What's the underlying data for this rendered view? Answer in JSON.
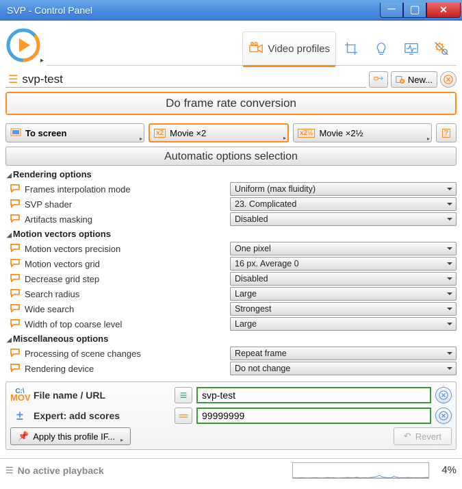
{
  "window": {
    "title": "SVP - Control Panel"
  },
  "tabs": {
    "video_profiles": "Video profiles"
  },
  "profile": {
    "name": "svp-test",
    "new_btn": "New..."
  },
  "panel": {
    "header": "Do frame rate conversion"
  },
  "modes": {
    "screen": "To screen",
    "x2": "Movie ×2",
    "x25": "Movie ×2½"
  },
  "auto_header": "Automatic options selection",
  "sections": {
    "rendering": "Rendering options",
    "motion": "Motion vectors options",
    "misc": "Miscellaneous options"
  },
  "options": {
    "frames_interp": {
      "label": "Frames interpolation mode",
      "value": "Uniform (max fluidity)"
    },
    "svp_shader": {
      "label": "SVP shader",
      "value": "23. Complicated"
    },
    "artifacts": {
      "label": "Artifacts masking",
      "value": "Disabled"
    },
    "mv_precision": {
      "label": "Motion vectors precision",
      "value": "One pixel"
    },
    "mv_grid": {
      "label": "Motion vectors grid",
      "value": "16 px. Average 0"
    },
    "decrease_grid": {
      "label": "Decrease grid step",
      "value": "Disabled"
    },
    "search_radius": {
      "label": "Search radius",
      "value": "Large"
    },
    "wide_search": {
      "label": "Wide search",
      "value": "Strongest"
    },
    "width_coarse": {
      "label": "Width of top coarse level",
      "value": "Large"
    },
    "scene_changes": {
      "label": "Processing of scene changes",
      "value": "Repeat frame"
    },
    "render_device": {
      "label": "Rendering device",
      "value": "Do not change"
    }
  },
  "bottom": {
    "filename_label": "File name / URL",
    "filename_value": "svp-test",
    "expert_label": "Expert: add scores",
    "expert_value": "99999999",
    "apply_if": "Apply this profile IF...",
    "revert": "Revert",
    "mov_badge": "C:\\\nMOV"
  },
  "status": {
    "text": "No active playback",
    "percent": "4%"
  },
  "chart_data": {
    "type": "line",
    "title": "",
    "xlabel": "",
    "ylabel": "",
    "ylim": [
      0,
      100
    ],
    "values": [
      2,
      1,
      2,
      3,
      2,
      1,
      2,
      2,
      3,
      2,
      1,
      2,
      4,
      2,
      3,
      2,
      1,
      2,
      3,
      4,
      3,
      2,
      5,
      3,
      2,
      3,
      2,
      4,
      6,
      10,
      18,
      8,
      4,
      3,
      2,
      12,
      6,
      3,
      2,
      3,
      4,
      3,
      2,
      3,
      2,
      3,
      4,
      4
    ]
  }
}
